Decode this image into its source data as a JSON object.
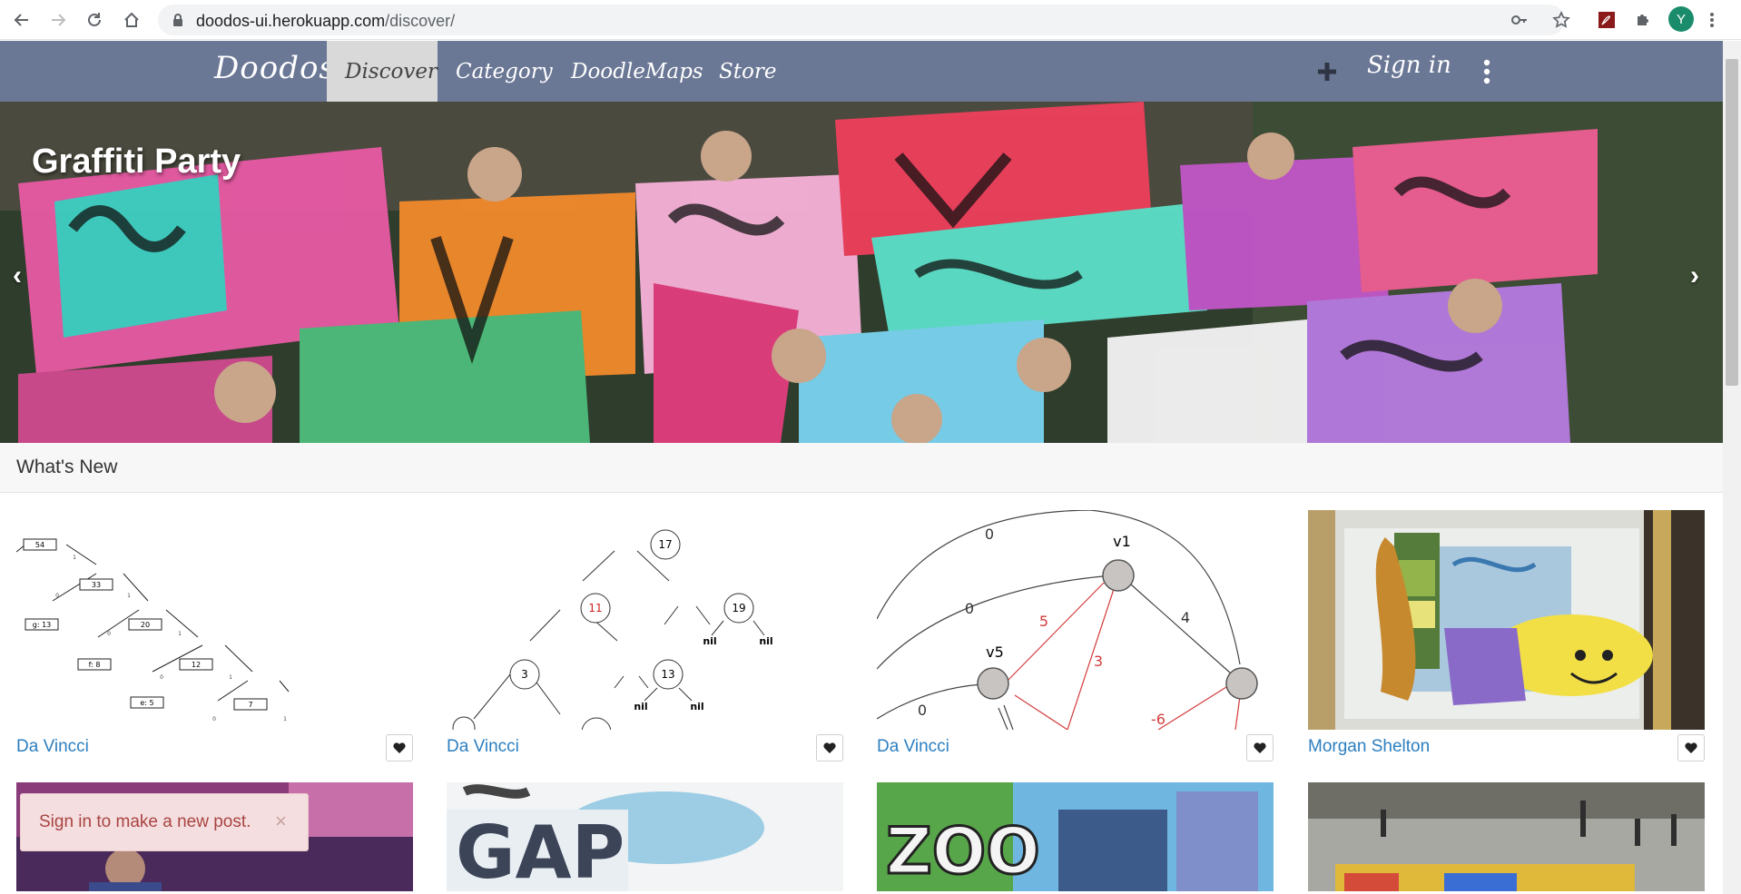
{
  "browser": {
    "url_host": "doodos-ui.herokuapp.com",
    "url_path": "/discover/",
    "profile_initial": "Y"
  },
  "navbar": {
    "brand": "Doodos",
    "items": [
      {
        "label": "Discover",
        "active": true
      },
      {
        "label": "Category",
        "active": false
      },
      {
        "label": "DoodleMaps",
        "active": false
      },
      {
        "label": "Store",
        "active": false
      }
    ],
    "signin_label": "Sign in",
    "bg_color": "#6a7795"
  },
  "hero": {
    "title": "Graffiti Party",
    "prev_arrow": "‹",
    "next_arrow": "›"
  },
  "section": {
    "title": "What's New"
  },
  "cards": [
    {
      "author": "Da Vincci",
      "image": "huffman-tree-diagram"
    },
    {
      "author": "Da Vincci",
      "image": "red-black-tree-diagram"
    },
    {
      "author": "Da Vincci",
      "image": "weighted-graph-diagram"
    },
    {
      "author": "Morgan Shelton",
      "image": "graffiti-wall-photo"
    }
  ],
  "huffman": {
    "nodes": [
      "54",
      "33",
      "g: 13",
      "20",
      "f: 8",
      "12",
      "e: 5",
      "7"
    ],
    "edges": [
      "1",
      "0",
      "1",
      "0",
      "1",
      "0",
      "1",
      "0",
      "1"
    ]
  },
  "rbtree": {
    "nodes": [
      "17",
      "11",
      "19",
      "3",
      "13"
    ],
    "nils": [
      "nil",
      "nil",
      "nil",
      "nil"
    ]
  },
  "graph": {
    "vertices": [
      "v1",
      "v5"
    ],
    "weights": [
      "0",
      "0",
      "5",
      "4",
      "3",
      "0",
      "-6"
    ]
  },
  "toast": {
    "message": "Sign in to make a new post.",
    "close": "×"
  }
}
